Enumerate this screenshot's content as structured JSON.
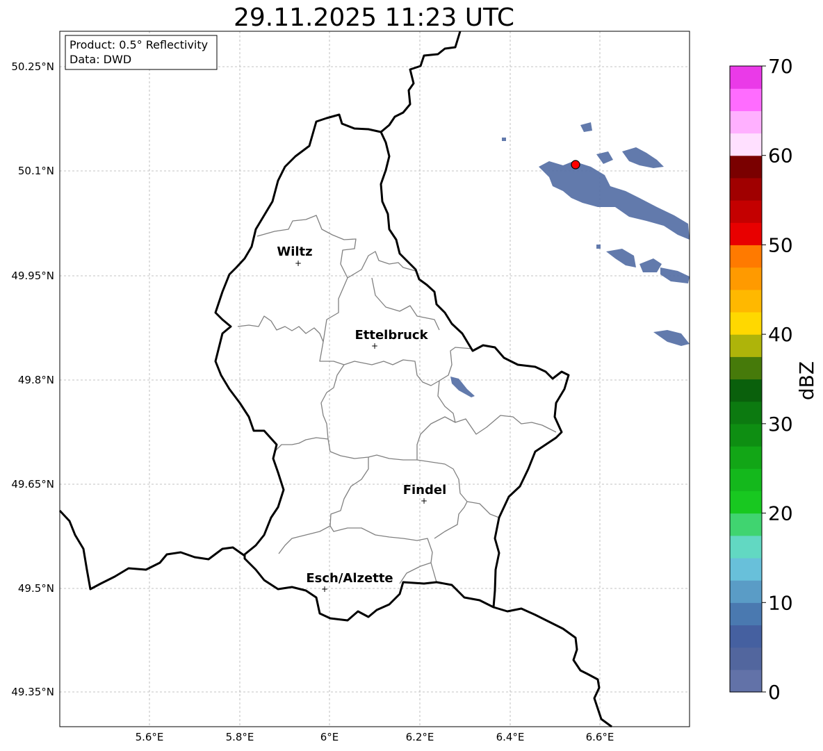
{
  "title": "29.11.2025 11:23 UTC",
  "info_box": {
    "product": "Product: 0.5° Reflectivity",
    "data_source": "Data: DWD"
  },
  "axes": {
    "lon_ticks": [
      "5.6°E",
      "5.8°E",
      "6°E",
      "6.2°E",
      "6.4°E",
      "6.6°E"
    ],
    "lat_ticks": [
      "50.25°N",
      "50.1°N",
      "49.95°N",
      "49.8°N",
      "49.65°N",
      "49.5°N",
      "49.35°N"
    ],
    "lon_range": [
      5.4,
      6.8
    ],
    "lat_range": [
      49.3,
      50.3
    ],
    "grid": true
  },
  "cities": [
    {
      "name": "Wiltz",
      "lon": 5.93,
      "lat": 49.966
    },
    {
      "name": "Ettelbruck",
      "lon": 6.1,
      "lat": 49.85
    },
    {
      "name": "Findel",
      "lon": 6.21,
      "lat": 49.626
    },
    {
      "name": "Esch/Alzette",
      "lon": 5.99,
      "lat": 49.498
    }
  ],
  "radar_site": {
    "lon": 6.548,
    "lat": 50.11,
    "color": "#ff0000"
  },
  "colorbar": {
    "label": "dBZ",
    "min": 0,
    "max": 70,
    "ticks": [
      "0",
      "10",
      "20",
      "30",
      "40",
      "50",
      "60",
      "70"
    ],
    "colors": [
      "#6272a8",
      "#52669e",
      "#4560a0",
      "#4a79b0",
      "#5a9cc6",
      "#68c0da",
      "#62d8c2",
      "#40d470",
      "#18c820",
      "#14b81c",
      "#12a616",
      "#0e8e12",
      "#0c7a10",
      "#0a600c",
      "#467a0a",
      "#aeb40a",
      "#ffd800",
      "#ffb800",
      "#ff9a00",
      "#ff7a00",
      "#e80000",
      "#c40000",
      "#a00000",
      "#7a0000",
      "#ffe0ff",
      "#ffb0ff",
      "#ff6cff",
      "#ea3ae8"
    ]
  },
  "precipitation_echoes_dbz": "about 2-6 dBZ, north-east of map near the radar site and small cells east of Ettelbruck"
}
